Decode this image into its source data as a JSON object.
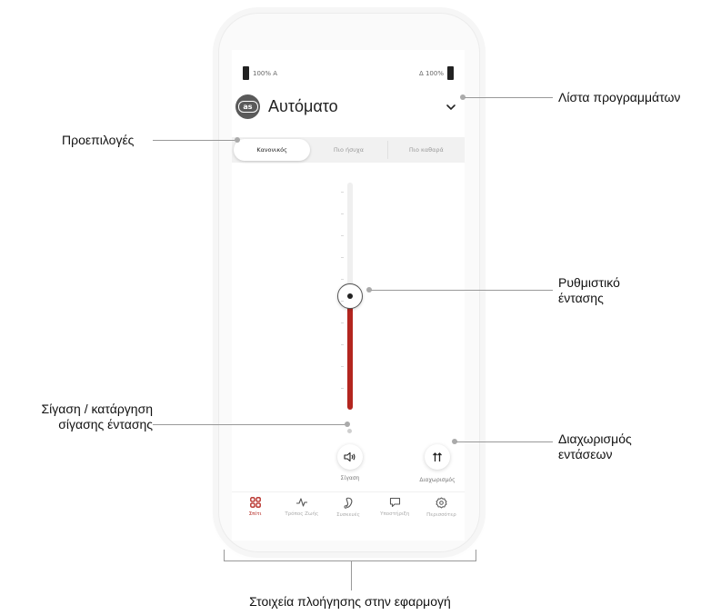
{
  "status": {
    "left": "100% A",
    "right": "Δ 100%"
  },
  "program": {
    "icon": "automatic-program-icon",
    "title": "Αυτόματο"
  },
  "presets": [
    {
      "label": "Κανονικός",
      "active": true
    },
    {
      "label": "Πιο ήσυχα",
      "active": false
    },
    {
      "label": "Πιο καθαρά",
      "active": false
    }
  ],
  "volume": {
    "level_percent": 50
  },
  "mute": {
    "label": "Σίγαση"
  },
  "split": {
    "label": "Διαχωρισμός"
  },
  "tabs": [
    {
      "label": "Σπίτι",
      "icon": "home-grid-icon",
      "active": true
    },
    {
      "label": "Τρόπος Ζωής",
      "icon": "activity-icon",
      "active": false
    },
    {
      "label": "Συσκευές",
      "icon": "hearing-aid-icon",
      "active": false
    },
    {
      "label": "Υποστήριξη",
      "icon": "chat-icon",
      "active": false
    },
    {
      "label": "Περισσότερ",
      "icon": "gear-icon",
      "active": false
    }
  ],
  "callouts": {
    "program_list": "Λίστα προγραμμάτων",
    "presets": "Προεπιλογές",
    "volume_line1": "Ρυθμιστικό",
    "volume_line2": "έντασης",
    "mute_line1": "Σίγαση / κατάργηση",
    "mute_line2": "σίγασης έντασης",
    "split_line1": "Διαχωρισμός",
    "split_line2": "εντάσεων",
    "navigation": "Στοιχεία πλοήγησης στην εφαρμογή"
  },
  "colors": {
    "accent": "#b3251f",
    "track": "#efefef"
  }
}
